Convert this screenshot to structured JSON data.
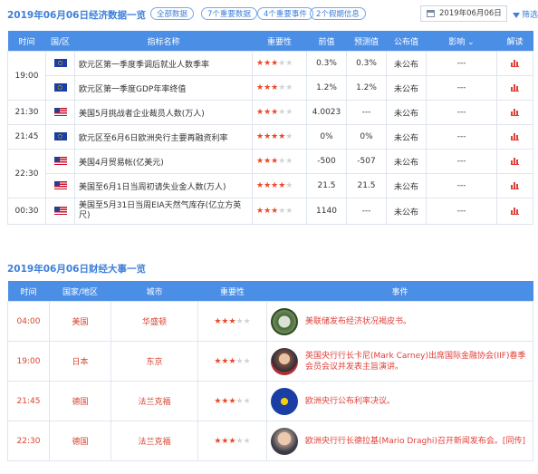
{
  "header": {
    "title": "2019年06月06日经济数据一览",
    "filters": [
      "全部数据",
      "7个重要数据",
      "4个重要事件",
      "2个假期信息"
    ],
    "date_value": "2019年06月06日",
    "filter_label": "筛选"
  },
  "econ_table": {
    "columns": [
      "时间",
      "国/区",
      "指标名称",
      "重要性",
      "前值",
      "预测值",
      "公布值",
      "影响",
      "解读"
    ],
    "rows": [
      {
        "time": "19:00",
        "flag": "eu",
        "name": "欧元区第一季度季调后就业人数季率",
        "stars": 3,
        "prev": "0.3%",
        "forecast": "0.3%",
        "actual": "未公布",
        "impact": "---"
      },
      {
        "time": "",
        "flag": "eu",
        "name": "欧元区第一季度GDP年率终值",
        "stars": 3,
        "prev": "1.2%",
        "forecast": "1.2%",
        "actual": "未公布",
        "impact": "---"
      },
      {
        "time": "21:30",
        "flag": "us",
        "name": "美国5月挑战者企业裁员人数(万人)",
        "stars": 3,
        "prev": "4.0023",
        "forecast": "---",
        "actual": "未公布",
        "impact": "---"
      },
      {
        "time": "21:45",
        "flag": "eu",
        "name": "欧元区至6月6日欧洲央行主要再融资利率",
        "stars": 4,
        "prev": "0%",
        "forecast": "0%",
        "actual": "未公布",
        "impact": "---"
      },
      {
        "time": "22:30",
        "flag": "us",
        "name": "美国4月贸易帐(亿美元)",
        "stars": 3,
        "prev": "-500",
        "forecast": "-507",
        "actual": "未公布",
        "impact": "---"
      },
      {
        "time": "",
        "flag": "us",
        "name": "美国至6月1日当周初请失业金人数(万人)",
        "stars": 4,
        "prev": "21.5",
        "forecast": "21.5",
        "actual": "未公布",
        "impact": "---"
      },
      {
        "time": "00:30",
        "flag": "us",
        "name": "美国至5月31日当周EIA天然气库存(亿立方英尺)",
        "stars": 3,
        "prev": "1140",
        "forecast": "---",
        "actual": "未公布",
        "impact": "---"
      }
    ]
  },
  "events": {
    "title": "2019年06月06日财经大事一览",
    "columns": [
      "时间",
      "国家/地区",
      "城市",
      "重要性",
      "事件"
    ],
    "rows": [
      {
        "time": "04:00",
        "country": "美国",
        "city": "华盛顿",
        "stars": 3,
        "avatar": "fed-seal",
        "event": "美联储发布经济状况褐皮书。"
      },
      {
        "time": "19:00",
        "country": "日本",
        "city": "东京",
        "stars": 3,
        "avatar": "carney-portrait",
        "event": "英国央行行长卡尼(Mark Carney)出席国际金融协会(IIF)春季会员会议并发表主旨演讲。"
      },
      {
        "time": "21:45",
        "country": "德国",
        "city": "法兰克福",
        "stars": 3,
        "avatar": "ecb-logo",
        "event": "欧洲央行公布利率决议。"
      },
      {
        "time": "22:30",
        "country": "德国",
        "city": "法兰克福",
        "stars": 3,
        "avatar": "draghi-portrait",
        "event": "欧洲央行行长德拉基(Mario Draghi)召开新闻发布会。[同传]"
      }
    ]
  },
  "colors": {
    "accent": "#4b8ee6",
    "star": "#e84a2a",
    "event_text": "#d8452f"
  }
}
